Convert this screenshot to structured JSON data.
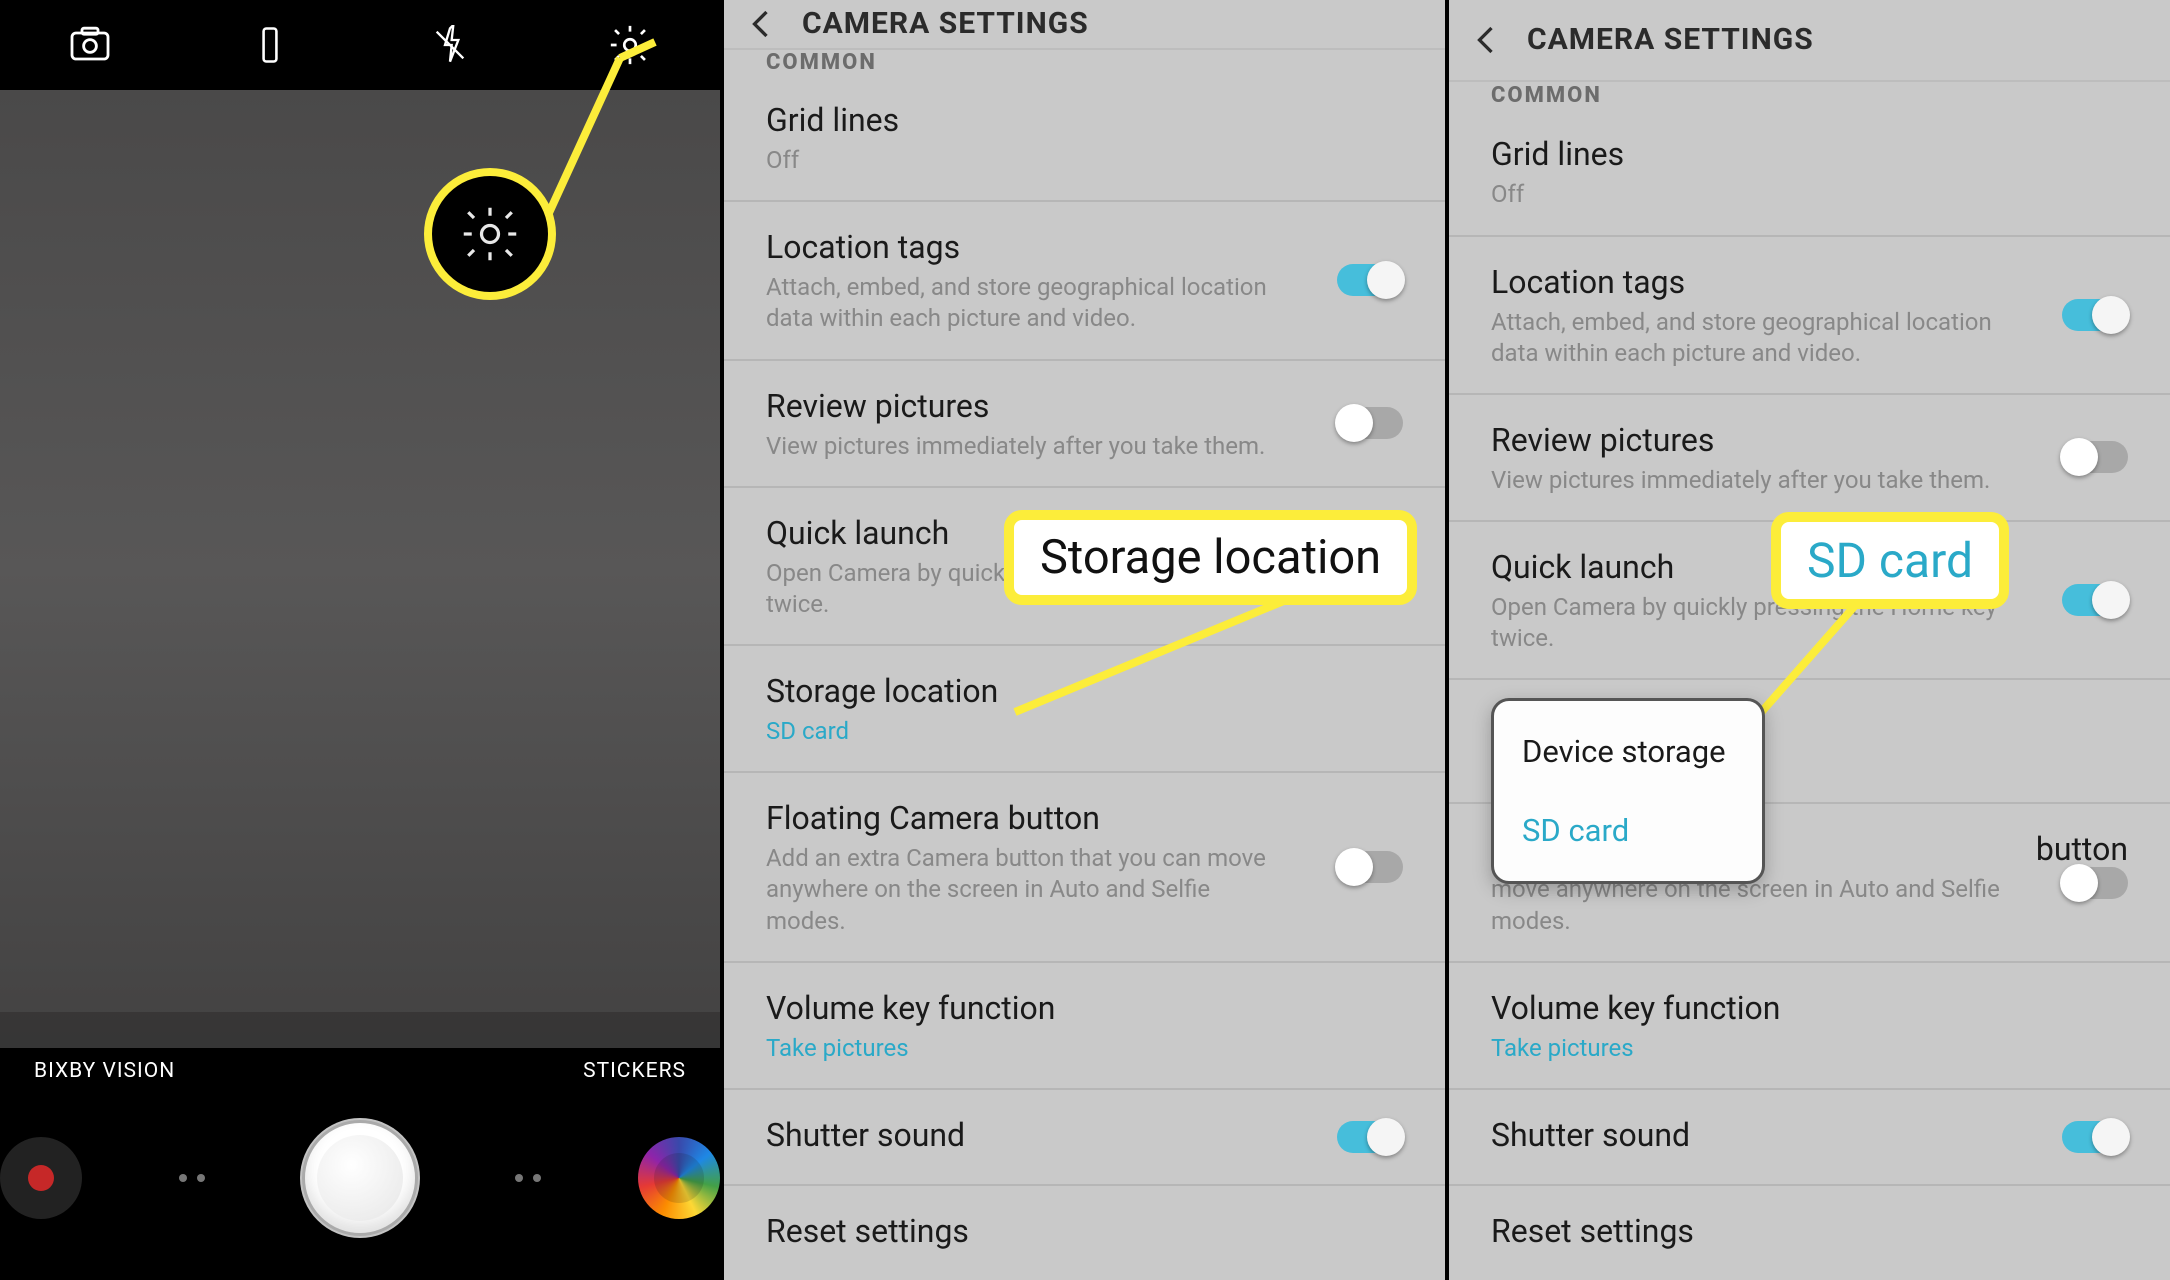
{
  "camera": {
    "bixby": "BIXBY VISION",
    "stickers": "STICKERS"
  },
  "settings_title": "CAMERA SETTINGS",
  "section": "COMMON",
  "items": {
    "grid": {
      "title": "Grid lines",
      "sub": "Off"
    },
    "loc": {
      "title": "Location tags",
      "sub": "Attach, embed, and store geographical location data within each picture and video."
    },
    "review": {
      "title": "Review pictures",
      "sub": "View pictures immediately after you take them."
    },
    "quick": {
      "title": "Quick launch",
      "sub": "Open Camera by quickly pressing the Home key twice."
    },
    "storage": {
      "title": "Storage location",
      "sub": "SD card"
    },
    "float": {
      "title": "Floating Camera button",
      "sub": "Add an extra Camera button that you can move anywhere on the screen in Auto and Selfie modes."
    },
    "volkey": {
      "title": "Volume key function",
      "sub": "Take pictures"
    },
    "shutter": {
      "title": "Shutter sound"
    },
    "reset": {
      "title": "Reset settings"
    }
  },
  "callouts": {
    "storage": "Storage location",
    "sdcard": "SD card"
  },
  "popup": {
    "opt1": "Device storage",
    "opt2": "SD card"
  },
  "panel3_float_sub_partial": "move anywhere on the screen in Auto and Selfie modes.",
  "panel3_float_title_tail": "button"
}
